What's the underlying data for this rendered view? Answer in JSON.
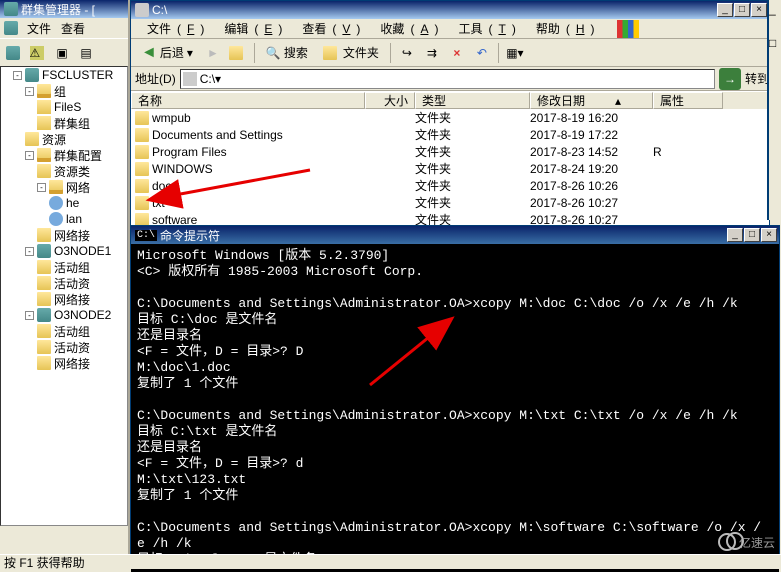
{
  "cluster": {
    "title": "群集管理器 - [",
    "menu": [
      "文件",
      "查看"
    ],
    "root": "FSCLUSTER",
    "nodes": [
      {
        "label": "组",
        "children": [
          {
            "label": "FileS"
          },
          {
            "label": "群集组"
          }
        ]
      },
      {
        "label": "资源"
      },
      {
        "label": "群集配置",
        "children": [
          {
            "label": "资源类"
          },
          {
            "label": "网络",
            "children": [
              {
                "label": "he"
              },
              {
                "label": "lan"
              }
            ]
          },
          {
            "label": "网络接"
          }
        ]
      },
      {
        "label": "O3NODE1",
        "children": [
          {
            "label": "活动组"
          },
          {
            "label": "活动资"
          },
          {
            "label": "网络接"
          }
        ]
      },
      {
        "label": "O3NODE2",
        "children": [
          {
            "label": "活动组"
          },
          {
            "label": "活动资"
          },
          {
            "label": "网络接"
          }
        ]
      }
    ]
  },
  "explorer": {
    "title": "C:\\",
    "menu": [
      {
        "t": "文件",
        "u": "F"
      },
      {
        "t": "编辑",
        "u": "E"
      },
      {
        "t": "查看",
        "u": "V"
      },
      {
        "t": "收藏",
        "u": "A"
      },
      {
        "t": "工具",
        "u": "T"
      },
      {
        "t": "帮助",
        "u": "H"
      }
    ],
    "back": "后退",
    "search": "搜索",
    "folders": "文件夹",
    "addr_label": "地址",
    "addr_u": "D",
    "addr_value": "C:\\",
    "go": "转到",
    "cols": {
      "name": "名称",
      "size": "大小",
      "type": "类型",
      "mod": "修改日期",
      "attr": "属性"
    },
    "rows": [
      {
        "name": "wmpub",
        "type": "文件夹",
        "mod": "2017-8-19 16:20",
        "attr": ""
      },
      {
        "name": "Documents and Settings",
        "type": "文件夹",
        "mod": "2017-8-19 17:22",
        "attr": ""
      },
      {
        "name": "Program Files",
        "type": "文件夹",
        "mod": "2017-8-23 14:52",
        "attr": "R"
      },
      {
        "name": "WINDOWS",
        "type": "文件夹",
        "mod": "2017-8-24 19:20",
        "attr": ""
      },
      {
        "name": "doc",
        "type": "文件夹",
        "mod": "2017-8-26 10:26",
        "attr": ""
      },
      {
        "name": "txt",
        "type": "文件夹",
        "mod": "2017-8-26 10:27",
        "attr": ""
      },
      {
        "name": "software",
        "type": "文件夹",
        "mod": "2017-8-26 10:27",
        "attr": ""
      }
    ]
  },
  "cmd": {
    "title": "命令提示符",
    "lines": [
      "Microsoft Windows [版本 5.2.3790]",
      "<C> 版权所有 1985-2003 Microsoft Corp.",
      "",
      "C:\\Documents and Settings\\Administrator.OA>xcopy M:\\doc C:\\doc /o /x /e /h /k",
      "目标 C:\\doc 是文件名",
      "还是目录名",
      "<F = 文件，D = 目录>? D",
      "M:\\doc\\1.doc",
      "复制了 1 个文件",
      "",
      "C:\\Documents and Settings\\Administrator.OA>xcopy M:\\txt C:\\txt /o /x /e /h /k",
      "目标 C:\\txt 是文件名",
      "还是目录名",
      "<F = 文件，D = 目录>? d",
      "M:\\txt\\123.txt",
      "复制了 1 个文件",
      "",
      "C:\\Documents and Settings\\Administrator.OA>xcopy M:\\software C:\\software /o /x /",
      "e /h /k",
      "目标 C:\\software 是文件名"
    ]
  },
  "status": "按 F1 获得帮助",
  "logo": "亿速云"
}
